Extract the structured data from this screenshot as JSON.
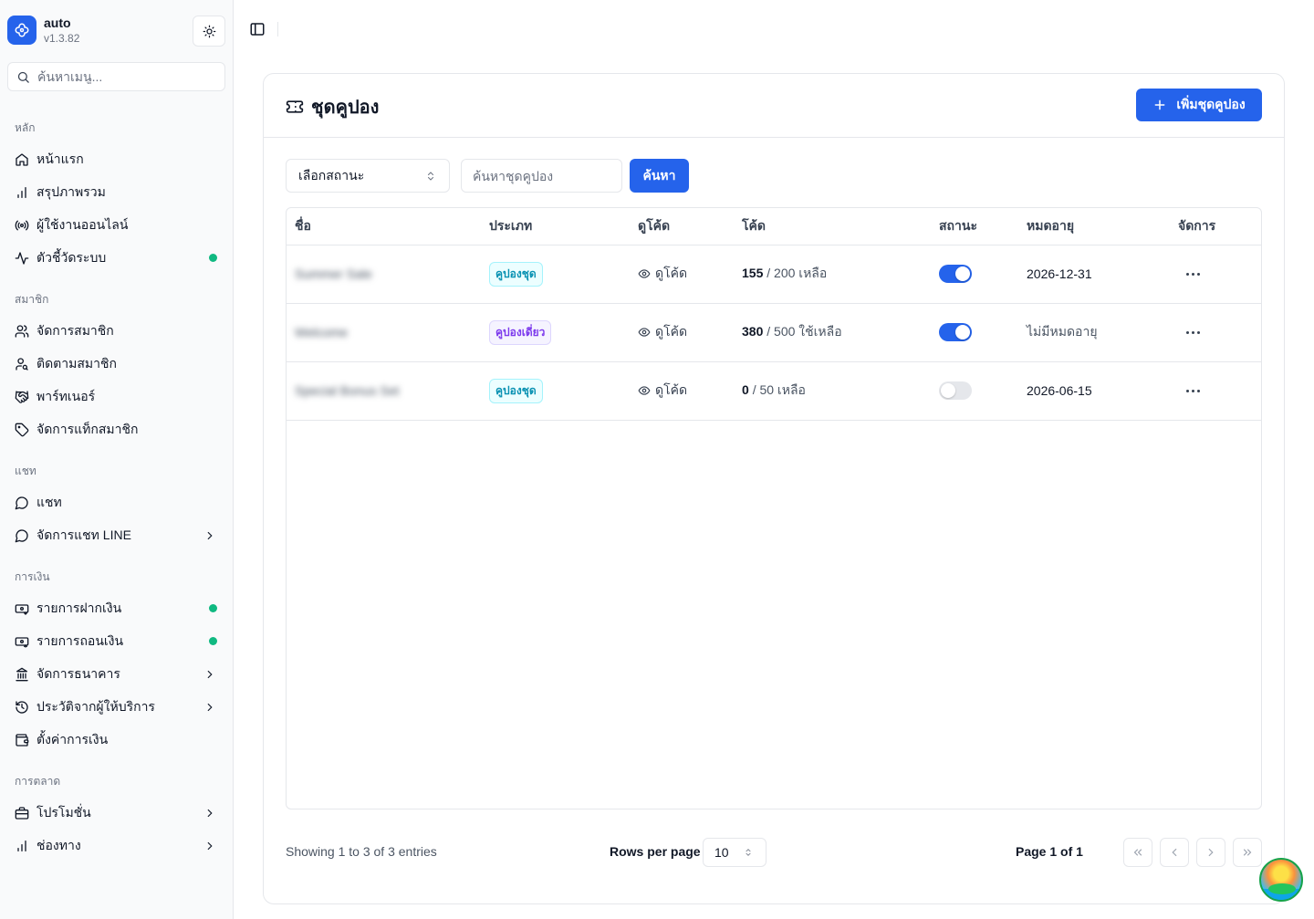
{
  "brand": {
    "name": "auto",
    "version": "v1.3.82"
  },
  "sidebar": {
    "search_placeholder": "ค้นหาเมนู...",
    "groups": [
      {
        "label": "หลัก",
        "items": [
          {
            "label": "หน้าแรก",
            "icon": "home-icon"
          },
          {
            "label": "สรุปภาพรวม",
            "icon": "bar-chart-icon"
          },
          {
            "label": "ผู้ใช้งานออนไลน์",
            "icon": "broadcast-icon"
          },
          {
            "label": "ตัวชี้วัดระบบ",
            "icon": "activity-icon",
            "status_dot": true
          }
        ]
      },
      {
        "label": "สมาชิก",
        "items": [
          {
            "label": "จัดการสมาชิก",
            "icon": "users-icon"
          },
          {
            "label": "ติดตามสมาชิก",
            "icon": "user-search-icon"
          },
          {
            "label": "พาร์ทเนอร์",
            "icon": "handshake-icon"
          },
          {
            "label": "จัดการแท็กสมาชิก",
            "icon": "tag-icon"
          }
        ]
      },
      {
        "label": "แชท",
        "items": [
          {
            "label": "แชท",
            "icon": "message-circle-icon"
          },
          {
            "label": "จัดการแชท LINE",
            "icon": "message-circle-icon",
            "has_chevron": true
          }
        ]
      },
      {
        "label": "การเงิน",
        "items": [
          {
            "label": "รายการฝากเงิน",
            "icon": "banknote-in-icon",
            "status_dot": true
          },
          {
            "label": "รายการถอนเงิน",
            "icon": "banknote-out-icon",
            "status_dot": true
          },
          {
            "label": "จัดการธนาคาร",
            "icon": "bank-icon",
            "has_chevron": true
          },
          {
            "label": "ประวัติจากผู้ให้บริการ",
            "icon": "history-icon",
            "has_chevron": true
          },
          {
            "label": "ตั้งค่าการเงิน",
            "icon": "wallet-icon"
          }
        ]
      },
      {
        "label": "การตลาด",
        "items": [
          {
            "label": "โปรโมชั่น",
            "icon": "briefcase-icon",
            "has_chevron": true
          },
          {
            "label": "ช่องทาง",
            "icon": "bar-chart-icon",
            "has_chevron": true
          }
        ]
      }
    ]
  },
  "page": {
    "title": "ชุดคูปอง",
    "add_button": "เพิ่มชุดคูปอง",
    "status_filter": "เลือกสถานะ",
    "search_placeholder": "ค้นหาชุดคูปอง",
    "search_button": "ค้นหา"
  },
  "table": {
    "headers": [
      "ชื่อ",
      "ประเภท",
      "ดูโค้ด",
      "โค้ด",
      "สถานะ",
      "หมดอายุ",
      "จัดการ"
    ],
    "rows": [
      {
        "name": "Summer Sale",
        "type": "คูปองชุด",
        "type_color": "cyan",
        "view": "ดูโค้ด",
        "code_count": "155",
        "code_rest": "/ 200 เหลือ",
        "active": true,
        "expiry": "2026-12-31",
        "expiry_muted": false
      },
      {
        "name": "Welcome",
        "type": "คูปองเดี่ยว",
        "type_color": "purple",
        "view": "ดูโค้ด",
        "code_count": "380",
        "code_rest": "/ 500 ใช้เหลือ",
        "active": true,
        "expiry": "ไม่มีหมดอายุ",
        "expiry_muted": true
      },
      {
        "name": "Special Bonus Set",
        "type": "คูปองชุด",
        "type_color": "cyan",
        "view": "ดูโค้ด",
        "code_count": "0",
        "code_rest": "/ 50 เหลือ",
        "active": false,
        "expiry": "2026-06-15",
        "expiry_muted": false
      }
    ]
  },
  "pagination": {
    "info": "Showing 1 to 3 of 3 entries",
    "rows_per_page_label": "Rows per page",
    "rows_per_page_value": "10",
    "page_label": "Page 1 of 1"
  },
  "colors": {
    "accent": "#2563eb",
    "status_dot": "#10b981"
  }
}
